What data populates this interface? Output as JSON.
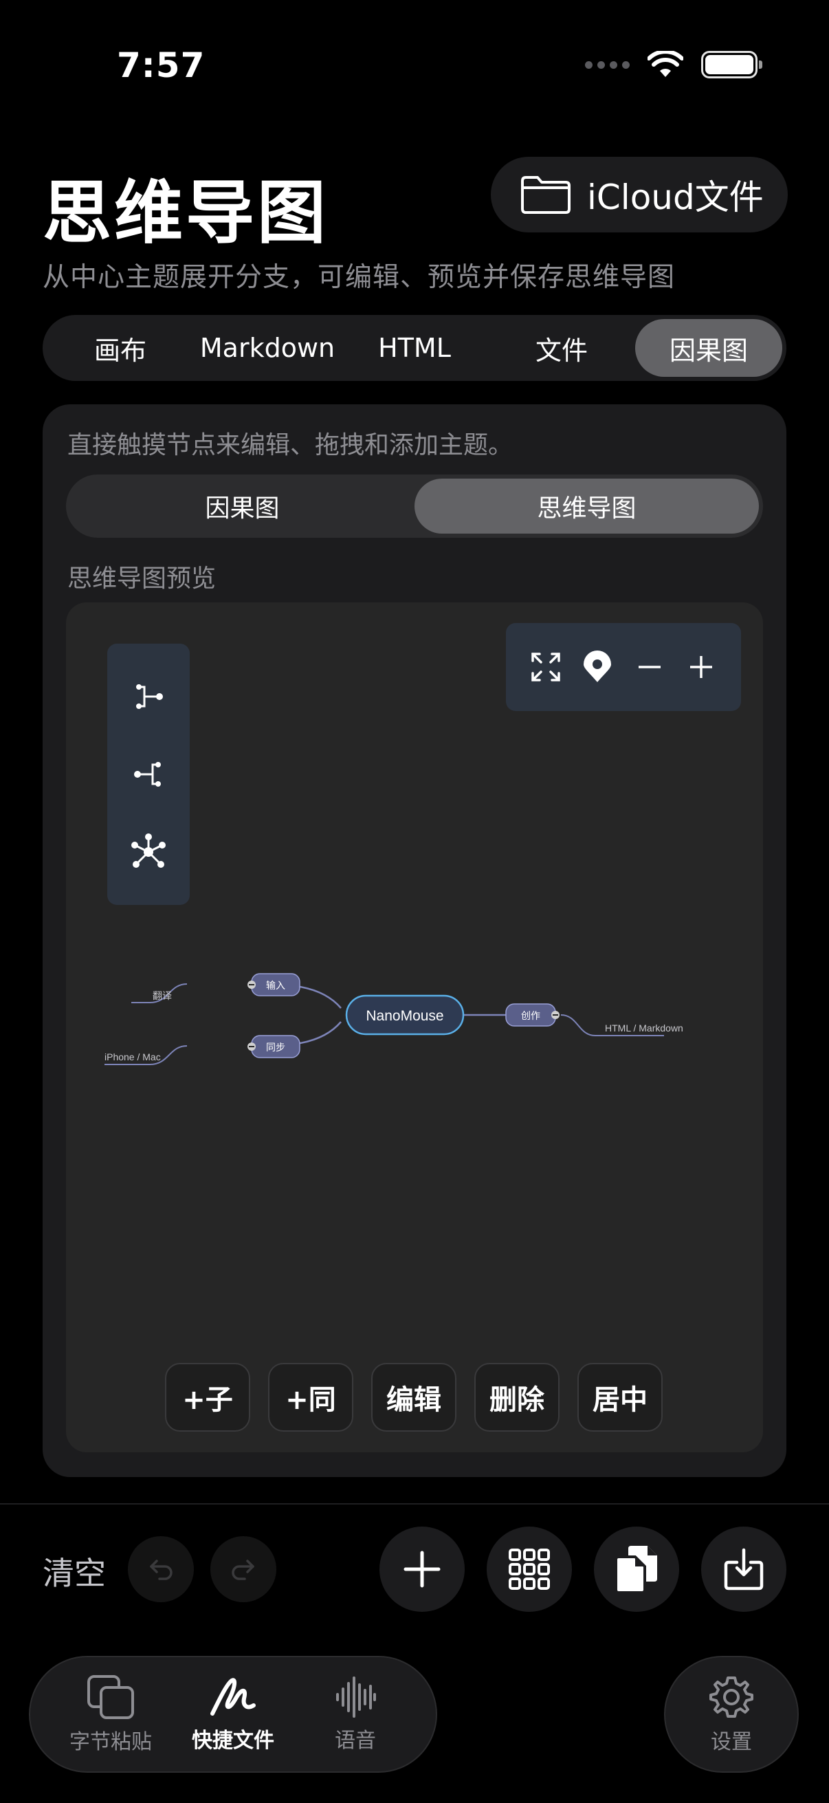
{
  "status": {
    "time": "7:57"
  },
  "header": {
    "title": "思维导图",
    "icloud_label": "iCloud文件",
    "subtitle": "从中心主题展开分支，可编辑、预览并保存思维导图"
  },
  "top_tabs": [
    {
      "label": "画布",
      "active": false
    },
    {
      "label": "Markdown",
      "active": false
    },
    {
      "label": "HTML",
      "active": false
    },
    {
      "label": "文件",
      "active": false
    },
    {
      "label": "因果图",
      "active": true
    }
  ],
  "panel": {
    "hint": "直接触摸节点来编辑、拖拽和添加主题。",
    "modes": [
      {
        "label": "因果图",
        "active": false
      },
      {
        "label": "思维导图",
        "active": true
      }
    ],
    "preview_label": "思维导图预览"
  },
  "mindmap": {
    "center": "NanoMouse",
    "nodes": {
      "input": "输入",
      "sync": "同步",
      "create": "创作"
    },
    "leaves": {
      "translate": "翻译",
      "devices": "iPhone / Mac",
      "formats": "HTML / Markdown"
    }
  },
  "actions": [
    "+子",
    "+同",
    "编辑",
    "删除",
    "居中"
  ],
  "toolbar": {
    "clear_label": "清空"
  },
  "tabbar": {
    "items": [
      {
        "label": "字节粘贴",
        "active": false
      },
      {
        "label": "快捷文件",
        "active": true
      },
      {
        "label": "语音",
        "active": false
      }
    ],
    "settings_label": "设置"
  },
  "colors": {
    "accent_node": "#5a5f8a",
    "center_border": "#5ab0e8",
    "panel": "#1c1c1e",
    "active_segment": "#636366"
  }
}
